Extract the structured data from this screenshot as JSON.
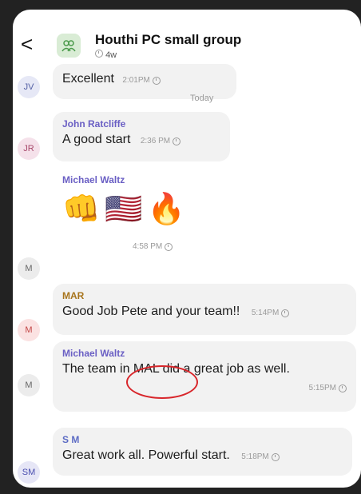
{
  "header": {
    "back": "<",
    "title": "Houthi PC small group",
    "subtitle": "4w"
  },
  "divider_label": "Today",
  "messages": [
    {
      "avatar": "JV",
      "sender": "",
      "text": "Excellent",
      "time": "2:01PM"
    },
    {
      "avatar": "JR",
      "sender": "John Ratcliffe",
      "text": "A good start",
      "time": "2:36 PM"
    },
    {
      "avatar": "M",
      "sender": "Michael Waltz",
      "text": "👊🇺🇸🔥",
      "time": "4:58 PM"
    },
    {
      "avatar": "M",
      "sender": "MAR",
      "text": "Good Job Pete and your team!!",
      "time": "5:14PM"
    },
    {
      "avatar": "M",
      "sender": "Michael Waltz",
      "text": "The team in MAL did a great job  as well.",
      "time": "5:15PM"
    },
    {
      "avatar": "SM",
      "sender": "S M",
      "text": "Great work all. Powerful start.",
      "time": "5:18PM"
    }
  ],
  "colors": {
    "annotation": "#d8262b",
    "sender_purple": "#6a5fc4",
    "bubble": "#f2f2f2"
  }
}
